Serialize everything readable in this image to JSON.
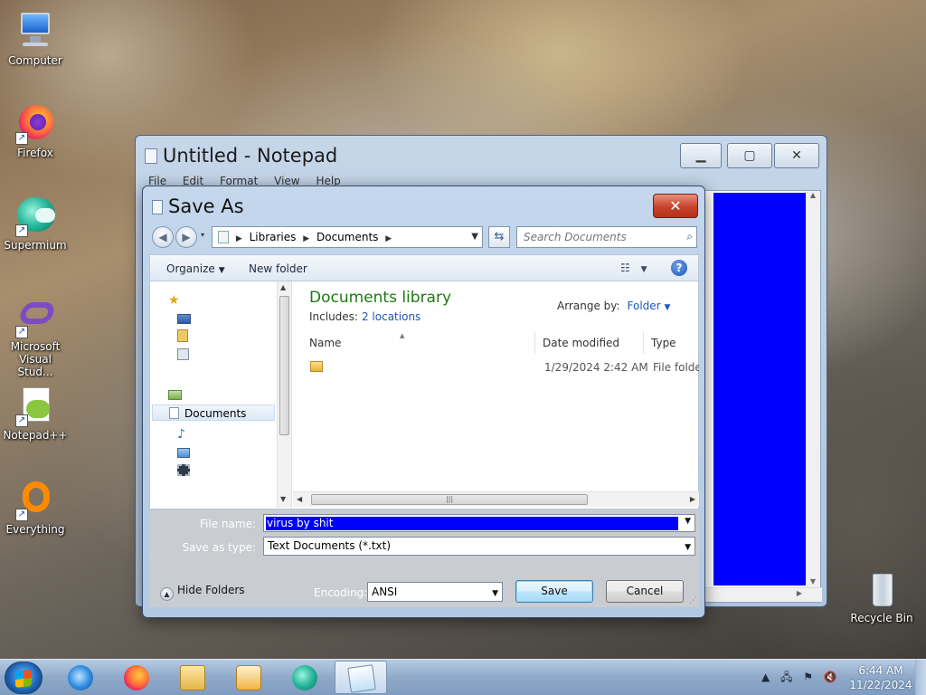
{
  "desktop": {
    "icons": [
      {
        "label": "Computer",
        "icon": "computer-icon"
      },
      {
        "label": "Firefox",
        "icon": "firefox-icon"
      },
      {
        "label": "Supermium",
        "icon": "supermium-icon"
      },
      {
        "label": "Microsoft Visual Stud...",
        "icon": "visual-studio-icon"
      },
      {
        "label": "Notepad++",
        "icon": "notepadpp-icon"
      },
      {
        "label": "Everything",
        "icon": "everything-icon"
      },
      {
        "label": "Recycle Bin",
        "icon": "recycle-bin-icon"
      }
    ]
  },
  "notepad": {
    "title": "Untitled - Notepad",
    "menu": [
      "File",
      "Edit",
      "Format",
      "View",
      "Help"
    ],
    "content_color": "#0000FF"
  },
  "dialog": {
    "title": "Save As",
    "close_glyph": "✕",
    "breadcrumb": [
      "Libraries",
      "Documents"
    ],
    "search_placeholder": "Search Documents",
    "toolbar": {
      "organize": "Organize",
      "new_folder": "New folder"
    },
    "nav": {
      "documents": "Documents"
    },
    "library": {
      "title": "Documents library",
      "includes_label": "Includes:",
      "includes_link": "2 locations",
      "arrange_label": "Arrange by:",
      "arrange_value": "Folder"
    },
    "columns": [
      "Name",
      "Date modified",
      "Type"
    ],
    "rows": [
      {
        "name": "",
        "date": "1/29/2024 2:42 AM",
        "type": "File folder"
      }
    ],
    "file_name_label": "File name:",
    "file_name_value": "virus by shit",
    "save_as_type_label": "Save as type:",
    "save_as_type_value": "Text Documents (*.txt)",
    "hide_folders": "Hide Folders",
    "encoding_label": "Encoding:",
    "encoding_value": "ANSI",
    "save_button": "Save",
    "cancel_button": "Cancel"
  },
  "taskbar": {
    "apps": [
      "internet-explorer-icon",
      "firefox-icon",
      "file-explorer-icon",
      "media-player-icon",
      "supermium-icon",
      "notepad-icon"
    ],
    "active_app": "notepad-icon",
    "time": "6:44 AM",
    "date": "11/22/2024"
  },
  "colors": {
    "selection": "#0000FF",
    "library_title": "#1E7A12",
    "link": "#1F56B8",
    "close_button": "#C7422A"
  }
}
